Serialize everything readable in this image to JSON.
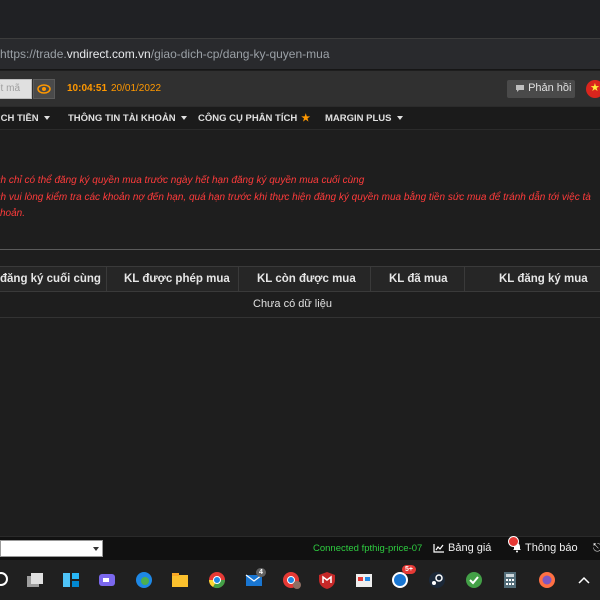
{
  "browser": {
    "url_scheme": "https://trade.",
    "url_domain": "vndirect.com.vn",
    "url_path": "/giao-dich-cp/dang-ky-quyen-mua"
  },
  "header": {
    "search_placeholder": "ết mã",
    "time": "10:04:51",
    "date": "20/01/2022",
    "feedback_label": "Phản hồi"
  },
  "menu": {
    "items": [
      {
        "label": "ỊCH TIỀN"
      },
      {
        "label": "THÔNG TIN TÀI KHOẢN"
      },
      {
        "label": "CÔNG CỤ PHÂN TÍCH"
      },
      {
        "label": "MARGIN PLUS"
      }
    ]
  },
  "notes": {
    "line1": "ách chỉ có thể đăng ký quyền mua trước ngày hết hạn đăng ký quyền mua cuối cùng",
    "line2": "ách vui lòng kiểm tra các khoản nợ đến hạn, quá hạn trước khi thực hiện đăng ký quyền mua bằng tiền sức mua để tránh dẫn tới việc tà",
    "line3": "i khoản."
  },
  "table": {
    "columns": [
      "đăng ký cuối cùng",
      "KL được phép mua",
      "KL còn được mua",
      "KL đã mua",
      "KL đăng ký mua"
    ],
    "empty_text": "Chưa có dữ liệu"
  },
  "footer": {
    "connection": "Connected fpthig-price-07",
    "price_board": "Bảng giá",
    "notifications": "Thông báo"
  },
  "taskbar": {
    "badges": {
      "mail": "4",
      "zalo": "5+"
    }
  },
  "colors": {
    "accent_orange": "#ff9800",
    "warning_red": "#ff3b3b",
    "connected_green": "#2ecc40"
  }
}
